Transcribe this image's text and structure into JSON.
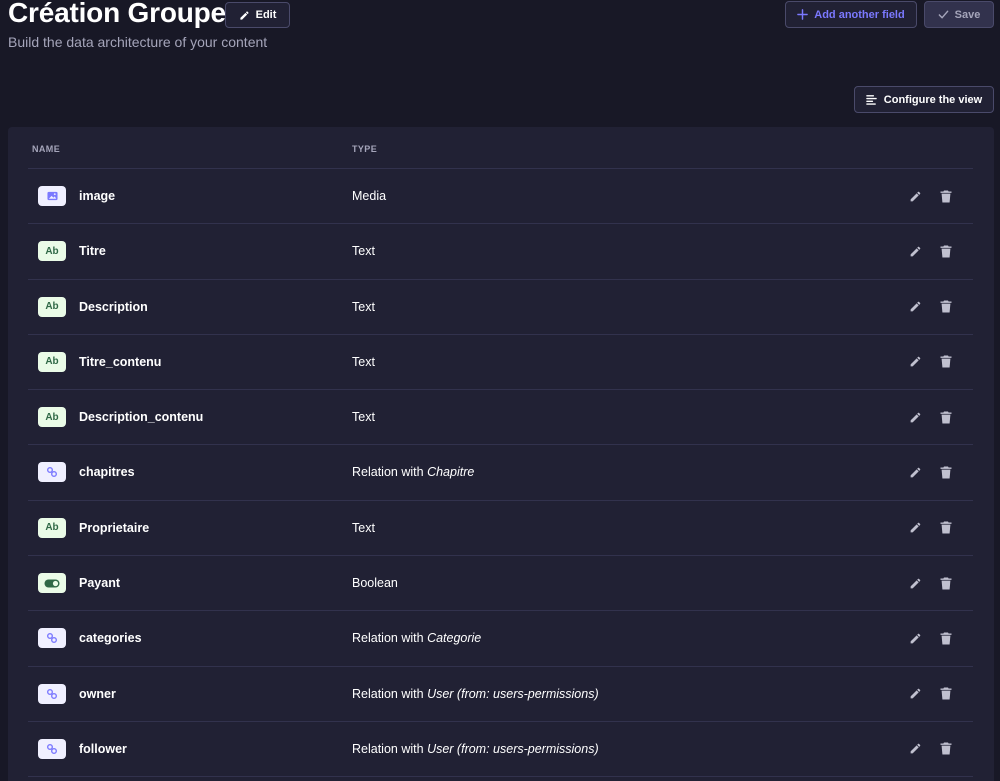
{
  "header": {
    "title": "Création Groupe",
    "edit_label": "Edit",
    "subtitle": "Build the data architecture of your content",
    "add_field_label": "Add another field",
    "save_label": "Save"
  },
  "toolbar": {
    "configure_label": "Configure the view"
  },
  "table": {
    "columns": [
      "NAME",
      "TYPE"
    ],
    "rows": [
      {
        "icon": "media-icon",
        "kind": "media",
        "name": "image",
        "type": "Media",
        "target": ""
      },
      {
        "icon": "text-icon",
        "kind": "text",
        "name": "Titre",
        "type": "Text",
        "target": ""
      },
      {
        "icon": "text-icon",
        "kind": "text",
        "name": "Description",
        "type": "Text",
        "target": ""
      },
      {
        "icon": "text-icon",
        "kind": "text",
        "name": "Titre_contenu",
        "type": "Text",
        "target": ""
      },
      {
        "icon": "text-icon",
        "kind": "text",
        "name": "Description_contenu",
        "type": "Text",
        "target": ""
      },
      {
        "icon": "relation-icon",
        "kind": "relation",
        "name": "chapitres",
        "type": "Relation with",
        "target": "Chapitre"
      },
      {
        "icon": "text-icon",
        "kind": "text",
        "name": "Proprietaire",
        "type": "Text",
        "target": ""
      },
      {
        "icon": "boolean-icon",
        "kind": "boolean",
        "name": "Payant",
        "type": "Boolean",
        "target": ""
      },
      {
        "icon": "relation-icon",
        "kind": "relation",
        "name": "categories",
        "type": "Relation with",
        "target": "Categorie"
      },
      {
        "icon": "relation-icon",
        "kind": "relation",
        "name": "owner",
        "type": "Relation with",
        "target": "User (from: users-permissions)"
      },
      {
        "icon": "relation-icon",
        "kind": "relation",
        "name": "follower",
        "type": "Relation with",
        "target": "User (from: users-permissions)"
      }
    ],
    "text_icon_label": "Ab"
  },
  "colors": {
    "background": "#181826",
    "panel": "#212134",
    "accent": "#7b79ff",
    "text_badge_bg": "#eafbe7",
    "text_badge_fg": "#2f6846",
    "relation_badge_bg": "#f0f0ff"
  }
}
